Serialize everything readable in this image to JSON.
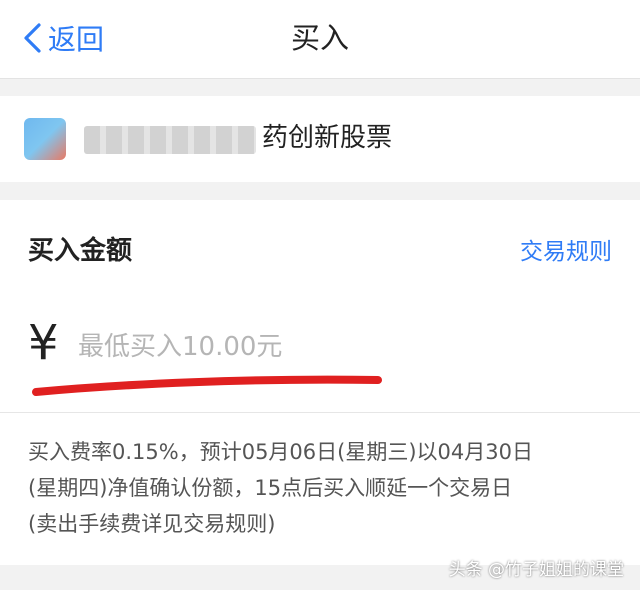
{
  "header": {
    "back_label": "返回",
    "title": "买入"
  },
  "fund": {
    "name_visible": "药创新股票"
  },
  "amount": {
    "label": "买入金额",
    "rules_link": "交易规则",
    "currency_symbol": "¥",
    "placeholder": "最低买入10.00元"
  },
  "info": {
    "lines": [
      "买入费率0.15%，预计05月06日(星期三)以04月30日",
      "(星期四)净值确认份额，15点后买入顺延一个交易日",
      "(卖出手续费详见交易规则)"
    ]
  },
  "watermark": "头条 @竹子姐姐的课堂",
  "colors": {
    "accent": "#2f7cf6",
    "annotation": "#e02020"
  }
}
